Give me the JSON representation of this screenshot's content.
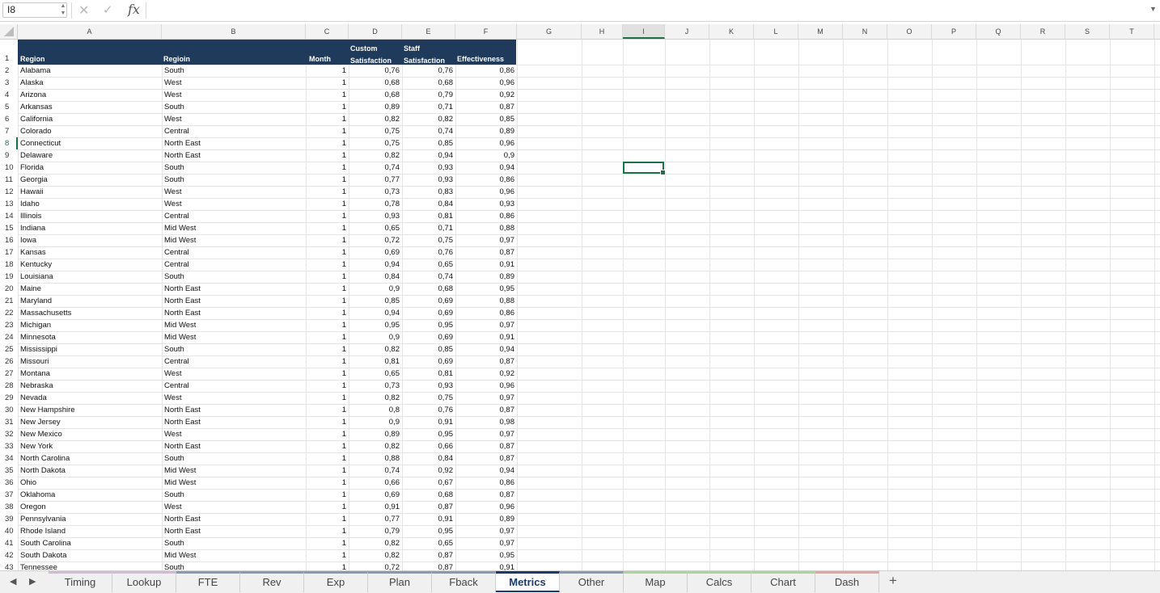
{
  "formula_bar": {
    "name_box": "I8",
    "cancel_icon": "✕",
    "confirm_icon": "✓",
    "fx_label": "fx",
    "formula": ""
  },
  "columns": [
    "A",
    "B",
    "C",
    "D",
    "E",
    "F",
    "G",
    "H",
    "I",
    "J",
    "K",
    "L",
    "M",
    "N",
    "O",
    "P",
    "Q",
    "R",
    "S",
    "T"
  ],
  "active_column": "I",
  "active_row": 8,
  "header_row": {
    "row_number": "1",
    "region": "Region",
    "regioin": "Regioin",
    "month": "Month",
    "custom_satisfaction": [
      "Custom",
      "Satisfaction"
    ],
    "staff_satisfaction": [
      "Staff",
      "Satisfaction"
    ],
    "effectiveness": "Effectiveness"
  },
  "rows": [
    {
      "n": "2",
      "region": "Alabama",
      "group": "South",
      "month": "1",
      "cs": "0,76",
      "ss": "0,76",
      "eff": "0,86"
    },
    {
      "n": "3",
      "region": "Alaska",
      "group": "West",
      "month": "1",
      "cs": "0,68",
      "ss": "0,68",
      "eff": "0,96"
    },
    {
      "n": "4",
      "region": "Arizona",
      "group": "West",
      "month": "1",
      "cs": "0,68",
      "ss": "0,79",
      "eff": "0,92"
    },
    {
      "n": "5",
      "region": "Arkansas",
      "group": "South",
      "month": "1",
      "cs": "0,89",
      "ss": "0,71",
      "eff": "0,87"
    },
    {
      "n": "6",
      "region": "California",
      "group": "West",
      "month": "1",
      "cs": "0,82",
      "ss": "0,82",
      "eff": "0,85"
    },
    {
      "n": "7",
      "region": "Colorado",
      "group": "Central",
      "month": "1",
      "cs": "0,75",
      "ss": "0,74",
      "eff": "0,89"
    },
    {
      "n": "8",
      "region": "Connecticut",
      "group": "North East",
      "month": "1",
      "cs": "0,75",
      "ss": "0,85",
      "eff": "0,96"
    },
    {
      "n": "9",
      "region": "Delaware",
      "group": "North East",
      "month": "1",
      "cs": "0,82",
      "ss": "0,94",
      "eff": "0,9"
    },
    {
      "n": "10",
      "region": "Florida",
      "group": "South",
      "month": "1",
      "cs": "0,74",
      "ss": "0,93",
      "eff": "0,94"
    },
    {
      "n": "11",
      "region": "Georgia",
      "group": "South",
      "month": "1",
      "cs": "0,77",
      "ss": "0,93",
      "eff": "0,86"
    },
    {
      "n": "12",
      "region": "Hawaii",
      "group": "West",
      "month": "1",
      "cs": "0,73",
      "ss": "0,83",
      "eff": "0,96"
    },
    {
      "n": "13",
      "region": "Idaho",
      "group": "West",
      "month": "1",
      "cs": "0,78",
      "ss": "0,84",
      "eff": "0,93"
    },
    {
      "n": "14",
      "region": "Illinois",
      "group": "Central",
      "month": "1",
      "cs": "0,93",
      "ss": "0,81",
      "eff": "0,86"
    },
    {
      "n": "15",
      "region": "Indiana",
      "group": "Mid West",
      "month": "1",
      "cs": "0,65",
      "ss": "0,71",
      "eff": "0,88"
    },
    {
      "n": "16",
      "region": "Iowa",
      "group": "Mid West",
      "month": "1",
      "cs": "0,72",
      "ss": "0,75",
      "eff": "0,97"
    },
    {
      "n": "17",
      "region": "Kansas",
      "group": "Central",
      "month": "1",
      "cs": "0,69",
      "ss": "0,76",
      "eff": "0,87"
    },
    {
      "n": "18",
      "region": "Kentucky",
      "group": "Central",
      "month": "1",
      "cs": "0,94",
      "ss": "0,65",
      "eff": "0,91"
    },
    {
      "n": "19",
      "region": "Louisiana",
      "group": "South",
      "month": "1",
      "cs": "0,84",
      "ss": "0,74",
      "eff": "0,89"
    },
    {
      "n": "20",
      "region": "Maine",
      "group": "North East",
      "month": "1",
      "cs": "0,9",
      "ss": "0,68",
      "eff": "0,95"
    },
    {
      "n": "21",
      "region": "Maryland",
      "group": "North East",
      "month": "1",
      "cs": "0,85",
      "ss": "0,69",
      "eff": "0,88"
    },
    {
      "n": "22",
      "region": "Massachusetts",
      "group": "North East",
      "month": "1",
      "cs": "0,94",
      "ss": "0,69",
      "eff": "0,86"
    },
    {
      "n": "23",
      "region": "Michigan",
      "group": "Mid West",
      "month": "1",
      "cs": "0,95",
      "ss": "0,95",
      "eff": "0,97"
    },
    {
      "n": "24",
      "region": "Minnesota",
      "group": "Mid West",
      "month": "1",
      "cs": "0,9",
      "ss": "0,69",
      "eff": "0,91"
    },
    {
      "n": "25",
      "region": "Mississippi",
      "group": "South",
      "month": "1",
      "cs": "0,82",
      "ss": "0,85",
      "eff": "0,94"
    },
    {
      "n": "26",
      "region": "Missouri",
      "group": "Central",
      "month": "1",
      "cs": "0,81",
      "ss": "0,69",
      "eff": "0,87"
    },
    {
      "n": "27",
      "region": "Montana",
      "group": "West",
      "month": "1",
      "cs": "0,65",
      "ss": "0,81",
      "eff": "0,92"
    },
    {
      "n": "28",
      "region": "Nebraska",
      "group": "Central",
      "month": "1",
      "cs": "0,73",
      "ss": "0,93",
      "eff": "0,96"
    },
    {
      "n": "29",
      "region": "Nevada",
      "group": "West",
      "month": "1",
      "cs": "0,82",
      "ss": "0,75",
      "eff": "0,97"
    },
    {
      "n": "30",
      "region": "New Hampshire",
      "group": "North East",
      "month": "1",
      "cs": "0,8",
      "ss": "0,76",
      "eff": "0,87"
    },
    {
      "n": "31",
      "region": "New Jersey",
      "group": "North East",
      "month": "1",
      "cs": "0,9",
      "ss": "0,91",
      "eff": "0,98"
    },
    {
      "n": "32",
      "region": "New Mexico",
      "group": "West",
      "month": "1",
      "cs": "0,89",
      "ss": "0,95",
      "eff": "0,97"
    },
    {
      "n": "33",
      "region": "New York",
      "group": "North East",
      "month": "1",
      "cs": "0,82",
      "ss": "0,66",
      "eff": "0,87"
    },
    {
      "n": "34",
      "region": "North Carolina",
      "group": "South",
      "month": "1",
      "cs": "0,88",
      "ss": "0,84",
      "eff": "0,87"
    },
    {
      "n": "35",
      "region": "North Dakota",
      "group": "Mid West",
      "month": "1",
      "cs": "0,74",
      "ss": "0,92",
      "eff": "0,94"
    },
    {
      "n": "36",
      "region": "Ohio",
      "group": "Mid West",
      "month": "1",
      "cs": "0,66",
      "ss": "0,67",
      "eff": "0,86"
    },
    {
      "n": "37",
      "region": "Oklahoma",
      "group": "South",
      "month": "1",
      "cs": "0,69",
      "ss": "0,68",
      "eff": "0,87"
    },
    {
      "n": "38",
      "region": "Oregon",
      "group": "West",
      "month": "1",
      "cs": "0,91",
      "ss": "0,87",
      "eff": "0,96"
    },
    {
      "n": "39",
      "region": "Pennsylvania",
      "group": "North East",
      "month": "1",
      "cs": "0,77",
      "ss": "0,91",
      "eff": "0,89"
    },
    {
      "n": "40",
      "region": "Rhode Island",
      "group": "North East",
      "month": "1",
      "cs": "0,79",
      "ss": "0,95",
      "eff": "0,97"
    },
    {
      "n": "41",
      "region": "South Carolina",
      "group": "South",
      "month": "1",
      "cs": "0,82",
      "ss": "0,65",
      "eff": "0,97"
    },
    {
      "n": "42",
      "region": "South Dakota",
      "group": "Mid West",
      "month": "1",
      "cs": "0,82",
      "ss": "0,87",
      "eff": "0,95"
    },
    {
      "n": "43",
      "region": "Tennessee",
      "group": "South",
      "month": "1",
      "cs": "0,72",
      "ss": "0,87",
      "eff": "0,91"
    }
  ],
  "tabs": [
    {
      "label": "Timing",
      "color": "#d8b8d8",
      "active": false
    },
    {
      "label": "Lookup",
      "color": "#d8b8d8",
      "active": false
    },
    {
      "label": "FTE",
      "color": "#8a9ab0",
      "active": false
    },
    {
      "label": "Rev",
      "color": "#8a9ab0",
      "active": false
    },
    {
      "label": "Exp",
      "color": "#8a9ab0",
      "active": false
    },
    {
      "label": "Plan",
      "color": "#8a9ab0",
      "active": false
    },
    {
      "label": "Fback",
      "color": "#8a9ab0",
      "active": false
    },
    {
      "label": "Metrics",
      "color": "#1a3a6a",
      "active": true
    },
    {
      "label": "Other",
      "color": "#8a9ab0",
      "active": false
    },
    {
      "label": "Map",
      "color": "#a8d898",
      "active": false
    },
    {
      "label": "Calcs",
      "color": "#a8d898",
      "active": false
    },
    {
      "label": "Chart",
      "color": "#a8d898",
      "active": false
    },
    {
      "label": "Dash",
      "color": "#e8a0a0",
      "active": false
    }
  ],
  "add_tab_label": "+",
  "nav_prev": "◀",
  "nav_next": "▶",
  "colors": {
    "header_fill": "#1f3a5a",
    "selection": "#1e7145"
  }
}
